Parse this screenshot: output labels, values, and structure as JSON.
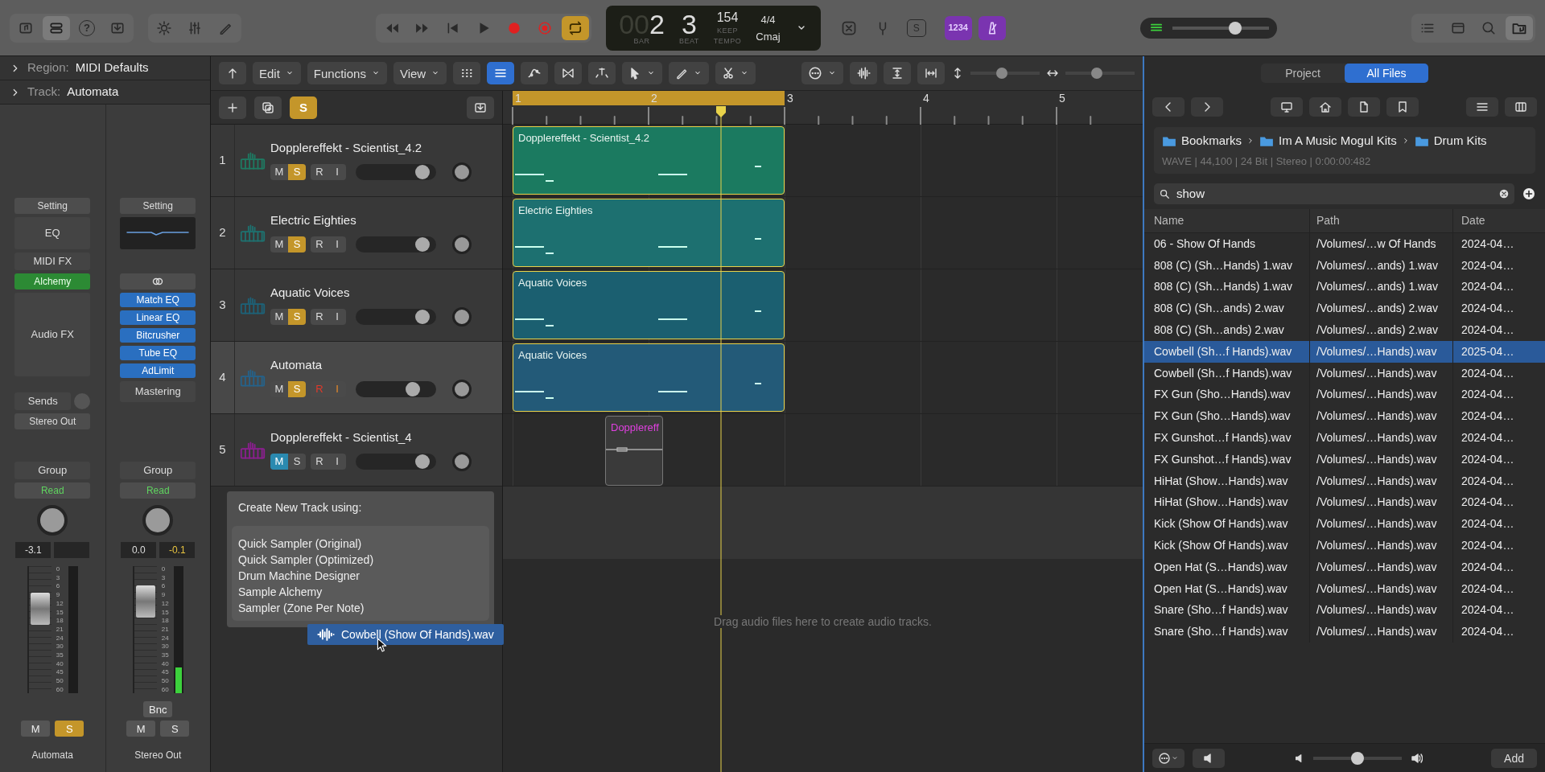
{
  "toolbar": {
    "inspector_on": true,
    "help_label": "?",
    "cycle_on": true,
    "lcd": {
      "bar_leading": "00",
      "bar": "2",
      "beat": "3",
      "bar_label": "BAR",
      "beat_label": "BEAT",
      "tempo": "154",
      "tempo_mode": "KEEP",
      "tempo_label": "TEMPO",
      "signature": "4/4",
      "key": "Cmaj"
    },
    "s_label": "S",
    "count_in": {
      "label": "1234",
      "on": true
    },
    "metronome_on": true,
    "master_volume": {
      "level": 0.65
    },
    "browser_on": true
  },
  "inspector": {
    "region": {
      "label": "Region:",
      "value": "MIDI Defaults"
    },
    "track": {
      "label": "Track:",
      "value": "Automata"
    },
    "strips": [
      {
        "kind": "instrument",
        "setting": "Setting",
        "eq": "EQ",
        "midi_fx": "MIDI FX",
        "instrument": "Alchemy",
        "audio_fx": "Audio FX",
        "sends": "Sends",
        "output": "Stereo Out",
        "group": "Group",
        "automation": "Read",
        "volume": "-3.1",
        "fader": {
          "level": 0.72
        },
        "meter": {
          "level": 0
        },
        "scale": [
          "0",
          "3",
          "6",
          "9",
          "12",
          "15",
          "18",
          "21",
          "24",
          "30",
          "35",
          "40",
          "45",
          "50",
          "60"
        ],
        "buttons": [
          {
            "label": "M",
            "on": false
          },
          {
            "label": "S",
            "on": true
          }
        ],
        "name": "Automata"
      },
      {
        "kind": "output",
        "setting": "Setting",
        "plugins": [
          "Match EQ",
          "Linear EQ",
          "Bitcrusher",
          "Tube EQ",
          "AdLimit"
        ],
        "audio_fx": "Mastering",
        "group": "Group",
        "automation": "Read",
        "volume": "0.0",
        "peak": "-0.1",
        "fader": {
          "level": 0.8
        },
        "meter": {
          "level": 0.2
        },
        "scale": [
          "0",
          "3",
          "6",
          "9",
          "12",
          "15",
          "18",
          "21",
          "24",
          "30",
          "35",
          "40",
          "45",
          "50",
          "60"
        ],
        "bounce": "Bnc",
        "buttons": [
          {
            "label": "M",
            "on": false
          },
          {
            "label": "S",
            "on": false
          }
        ],
        "name": "Stereo Out"
      }
    ]
  },
  "arrange": {
    "menus": [
      "Edit",
      "Functions",
      "View"
    ],
    "zoom_sliders": [
      {
        "level": 0.45
      },
      {
        "level": 0.45
      }
    ],
    "view_buttons": [
      {
        "selected": false
      },
      {
        "selected": true
      }
    ],
    "solo_label": "S",
    "solo_on": true,
    "ruler": [
      "1",
      "2",
      "3",
      "4",
      "5"
    ],
    "tracks": [
      {
        "number": "1",
        "name": "Dopplereffekt - Scientist_4.2",
        "color": "#1e7a62",
        "selected": false,
        "buttons": [
          {
            "label": "M",
            "on": false
          },
          {
            "label": "S",
            "on": true
          },
          {
            "label": "R",
            "on": false
          },
          {
            "label": "I",
            "on": false
          }
        ],
        "volume": {
          "level": 0.9
        },
        "regions": [
          {
            "kind": "midi",
            "name": "Dopplereffekt - Scientist_4.2",
            "color": "#1b7a60"
          }
        ]
      },
      {
        "number": "2",
        "name": "Electric Eighties",
        "color": "#1e7270",
        "selected": false,
        "buttons": [
          {
            "label": "M",
            "on": false
          },
          {
            "label": "S",
            "on": true
          },
          {
            "label": "R",
            "on": false
          },
          {
            "label": "I",
            "on": false
          }
        ],
        "volume": {
          "level": 0.9
        },
        "regions": [
          {
            "kind": "midi",
            "name": "Electric Eighties",
            "color": "#1d7070"
          }
        ]
      },
      {
        "number": "3",
        "name": "Aquatic Voices",
        "color": "#1d6278",
        "selected": false,
        "buttons": [
          {
            "label": "M",
            "on": false
          },
          {
            "label": "S",
            "on": true
          },
          {
            "label": "R",
            "on": false
          },
          {
            "label": "I",
            "on": false
          }
        ],
        "volume": {
          "level": 0.9
        },
        "regions": [
          {
            "kind": "midi",
            "name": "Aquatic Voices",
            "color": "#1b5f70"
          }
        ]
      },
      {
        "number": "4",
        "name": "Automata",
        "color": "#25628a",
        "selected": true,
        "buttons": [
          {
            "label": "M",
            "on": false
          },
          {
            "label": "S",
            "on": true
          },
          {
            "label": "R",
            "on": true
          },
          {
            "label": "I",
            "on": true
          }
        ],
        "volume": {
          "level": 0.75
        },
        "regions": [
          {
            "kind": "midi",
            "name": "Aquatic Voices",
            "color": "#235a78"
          }
        ]
      },
      {
        "number": "5",
        "name": "Dopplereffekt - Scientist_4",
        "color": "#8c1f90",
        "selected": false,
        "buttons": [
          {
            "label": "M",
            "on": true
          },
          {
            "label": "S",
            "on": false
          },
          {
            "label": "R",
            "on": false
          },
          {
            "label": "I",
            "on": false
          }
        ],
        "volume": {
          "level": 0.9
        },
        "regions": [
          {
            "kind": "audio",
            "name": "Dopplereff",
            "color": "#e040e0"
          }
        ]
      }
    ],
    "create_menu": {
      "title": "Create New Track using:",
      "options": [
        "Quick Sampler (Original)",
        "Quick Sampler (Optimized)",
        "Drum Machine Designer",
        "Sample Alchemy",
        "Sampler (Zone Per Note)"
      ]
    },
    "drag_item": {
      "name": "Cowbell (Show Of Hands).wav"
    },
    "drop_hint": "Drag audio files here to create audio tracks."
  },
  "browser": {
    "tabs": [
      {
        "label": "Project",
        "selected": false
      },
      {
        "label": "All Files",
        "selected": true
      }
    ],
    "path": [
      "Bookmarks",
      "Im A Music Mogul Kits",
      "Drum Kits"
    ],
    "info": "WAVE  |  44,100  |  24 Bit  |  Stereo  |  0:00:00:482",
    "search": {
      "value": "show"
    },
    "columns": [
      "Name",
      "Path",
      "Date"
    ],
    "rows": [
      {
        "cells": [
          "06 - Show Of Hands",
          "/Volumes/…w Of Hands",
          "2024-04…"
        ],
        "selected": false
      },
      {
        "cells": [
          "808 (C) (Sh…Hands) 1.wav",
          "/Volumes/…ands) 1.wav",
          "2024-04…"
        ],
        "selected": false
      },
      {
        "cells": [
          "808 (C) (Sh…Hands) 1.wav",
          "/Volumes/…ands) 1.wav",
          "2024-04…"
        ],
        "selected": false
      },
      {
        "cells": [
          "808 (C) (Sh…ands) 2.wav",
          "/Volumes/…ands) 2.wav",
          "2024-04…"
        ],
        "selected": false
      },
      {
        "cells": [
          "808 (C) (Sh…ands) 2.wav",
          "/Volumes/…ands) 2.wav",
          "2024-04…"
        ],
        "selected": false
      },
      {
        "cells": [
          "Cowbell (Sh…f Hands).wav",
          "/Volumes/…Hands).wav",
          "2025-04…"
        ],
        "selected": true
      },
      {
        "cells": [
          "Cowbell (Sh…f Hands).wav",
          "/Volumes/…Hands).wav",
          "2024-04…"
        ],
        "selected": false
      },
      {
        "cells": [
          "FX Gun (Sho…Hands).wav",
          "/Volumes/…Hands).wav",
          "2024-04…"
        ],
        "selected": false
      },
      {
        "cells": [
          "FX Gun (Sho…Hands).wav",
          "/Volumes/…Hands).wav",
          "2024-04…"
        ],
        "selected": false
      },
      {
        "cells": [
          "FX Gunshot…f Hands).wav",
          "/Volumes/…Hands).wav",
          "2024-04…"
        ],
        "selected": false
      },
      {
        "cells": [
          "FX Gunshot…f Hands).wav",
          "/Volumes/…Hands).wav",
          "2024-04…"
        ],
        "selected": false
      },
      {
        "cells": [
          "HiHat (Show…Hands).wav",
          "/Volumes/…Hands).wav",
          "2024-04…"
        ],
        "selected": false
      },
      {
        "cells": [
          "HiHat (Show…Hands).wav",
          "/Volumes/…Hands).wav",
          "2024-04…"
        ],
        "selected": false
      },
      {
        "cells": [
          "Kick (Show Of Hands).wav",
          "/Volumes/…Hands).wav",
          "2024-04…"
        ],
        "selected": false
      },
      {
        "cells": [
          "Kick (Show Of Hands).wav",
          "/Volumes/…Hands).wav",
          "2024-04…"
        ],
        "selected": false
      },
      {
        "cells": [
          "Open Hat (S…Hands).wav",
          "/Volumes/…Hands).wav",
          "2024-04…"
        ],
        "selected": false
      },
      {
        "cells": [
          "Open Hat (S…Hands).wav",
          "/Volumes/…Hands).wav",
          "2024-04…"
        ],
        "selected": false
      },
      {
        "cells": [
          "Snare (Sho…f Hands).wav",
          "/Volumes/…Hands).wav",
          "2024-04…"
        ],
        "selected": false
      },
      {
        "cells": [
          "Snare (Sho…f Hands).wav",
          "/Volumes/…Hands).wav",
          "2024-04…"
        ],
        "selected": false
      }
    ],
    "preview_volume": {
      "level": 0.5
    },
    "add": "Add"
  }
}
